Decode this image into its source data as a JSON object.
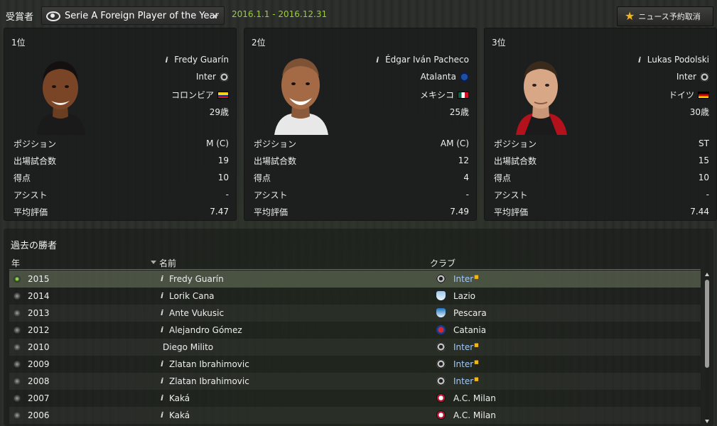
{
  "header": {
    "award_label": "受賞者",
    "award_name": "Serie A Foreign Player of the Year",
    "date_range": "2016.1.1 - 2016.12.31",
    "news_button": "ニュース予約取消"
  },
  "stat_labels": {
    "position": "ポジション",
    "appearances": "出場試合数",
    "goals": "得点",
    "assists": "アシスト",
    "avg_rating": "平均評価"
  },
  "winners": [
    {
      "rank": "1位",
      "name": "Fredy Guarín",
      "club": "Inter",
      "nation": "コロンビア",
      "age": "29歳",
      "position": "M (C)",
      "appearances": "19",
      "goals": "10",
      "assists": "-",
      "avg_rating": "7.47",
      "club_badge": "inter-badge-icon",
      "flag": "colombia-flag-icon"
    },
    {
      "rank": "2位",
      "name": "Édgar Iván Pacheco",
      "club": "Atalanta",
      "nation": "メキシコ",
      "age": "25歳",
      "position": "AM (C)",
      "appearances": "12",
      "goals": "4",
      "assists": "-",
      "avg_rating": "7.49",
      "club_badge": "atalanta-badge-icon",
      "flag": "mexico-flag-icon"
    },
    {
      "rank": "3位",
      "name": "Lukas Podolski",
      "club": "Inter",
      "nation": "ドイツ",
      "age": "30歳",
      "position": "ST",
      "appearances": "15",
      "goals": "10",
      "assists": "-",
      "avg_rating": "7.44",
      "club_badge": "inter-badge-icon",
      "flag": "germany-flag-icon"
    }
  ],
  "history": {
    "title": "過去の勝者",
    "columns": {
      "year": "年",
      "name": "名前",
      "club": "クラブ"
    },
    "rows": [
      {
        "year": "2015",
        "name": "Fredy Guarín",
        "club": "Inter",
        "badge": "inter-badge-icon"
      },
      {
        "year": "2014",
        "name": "Lorik Cana",
        "club": "Lazio",
        "badge": "lazio-badge-icon"
      },
      {
        "year": "2013",
        "name": "Ante Vukusic",
        "club": "Pescara",
        "badge": "pescara-badge-icon"
      },
      {
        "year": "2012",
        "name": "Alejandro Gómez",
        "club": "Catania",
        "badge": "catania-badge-icon"
      },
      {
        "year": "2010",
        "name": "Diego Milito",
        "club": "Inter",
        "badge": "inter-badge-icon"
      },
      {
        "year": "2009",
        "name": "Zlatan Ibrahimovic",
        "club": "Inter",
        "badge": "inter-badge-icon"
      },
      {
        "year": "2008",
        "name": "Zlatan Ibrahimovic",
        "club": "Inter",
        "badge": "inter-badge-icon"
      },
      {
        "year": "2007",
        "name": "Kaká",
        "club": "A.C. Milan",
        "badge": "milan-badge-icon"
      },
      {
        "year": "2006",
        "name": "Kaká",
        "club": "A.C. Milan",
        "badge": "milan-badge-icon"
      }
    ]
  },
  "colors": {
    "accent_green": "#9ccc3a",
    "link_blue": "#9ec8ff",
    "star_gold": "#f2b51c"
  }
}
